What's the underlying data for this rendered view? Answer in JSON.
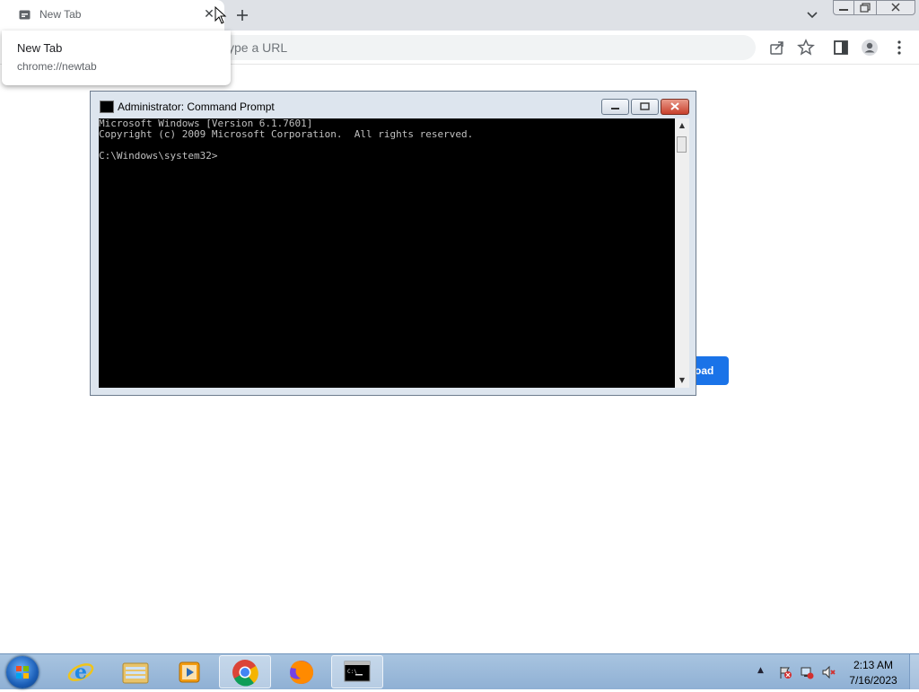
{
  "browser": {
    "tab": {
      "title": "New Tab",
      "close_glyph": "✕"
    },
    "hovercard": {
      "title": "New Tab",
      "url": "chrome://newtab"
    },
    "omnibox": {
      "placeholder_fragment": "ype a URL"
    },
    "page_button_fragment": "oad"
  },
  "cmd": {
    "title": "Administrator:  Command Prompt",
    "lines": [
      "Microsoft Windows [Version 6.1.7601]",
      "Copyright (c) 2009 Microsoft Corporation.  All rights reserved.",
      "",
      "C:\\Windows\\system32>"
    ],
    "scroll_up": "▲",
    "scroll_down": "▼"
  },
  "taskbar": {
    "apps": [
      {
        "name": "internet-explorer-icon"
      },
      {
        "name": "file-explorer-icon"
      },
      {
        "name": "media-player-icon"
      },
      {
        "name": "chrome-icon",
        "active": true
      },
      {
        "name": "firefox-icon"
      },
      {
        "name": "command-prompt-icon",
        "active": true
      }
    ],
    "tray_arrow": "▲",
    "clock": {
      "time": "2:13 AM",
      "date": "7/16/2023"
    }
  },
  "colors": {
    "accent": "#1a73e8",
    "console_bg": "#000000",
    "console_fg": "#c0c0c0"
  }
}
